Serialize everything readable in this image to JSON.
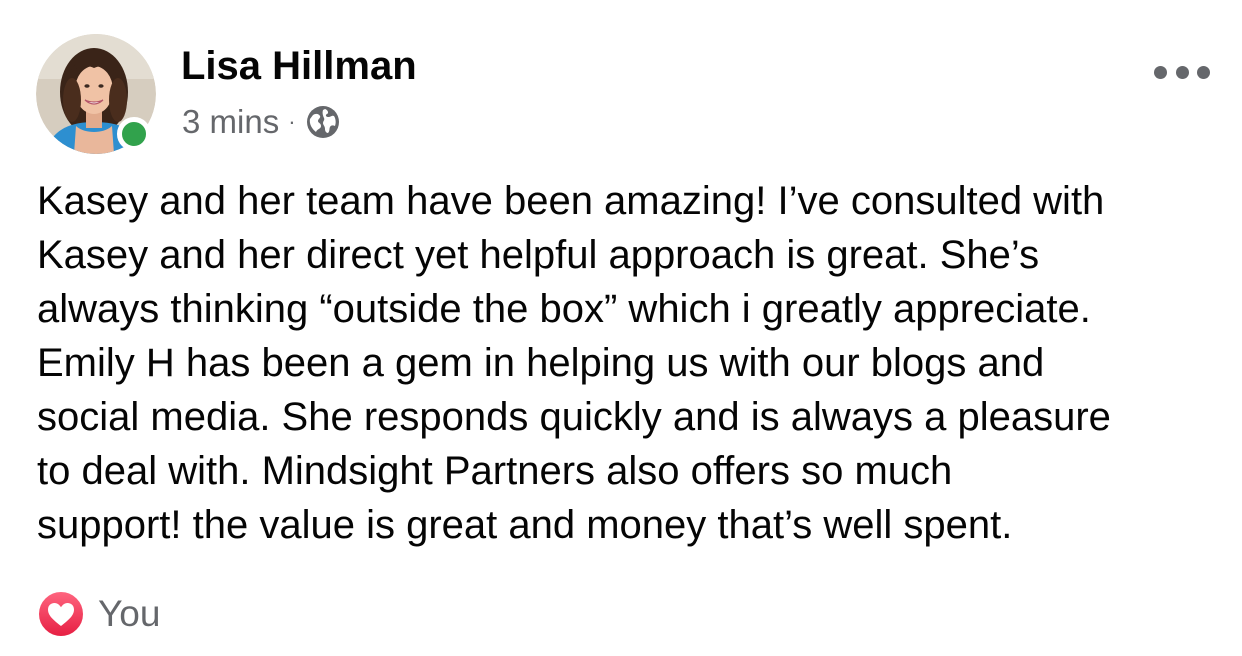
{
  "post": {
    "author": "Lisa Hillman",
    "timestamp": "3 mins",
    "separator": "·",
    "privacy_icon": "globe-icon",
    "online": true,
    "more_icon": "more-horizontal-icon",
    "body_lines": [
      "Kasey and her team have been amazing! I’ve consulted with",
      "Kasey and her direct yet helpful approach is great. She’s",
      "always thinking “outside the box” which i greatly appreciate.",
      "Emily H has been a gem in helping us with our blogs and",
      "social media. She responds quickly and is always a pleasure",
      "to deal with. Mindsight Partners also offers so much",
      "support! the value is great and money that’s well spent."
    ],
    "reactions": {
      "icon": "love-reaction-icon",
      "label": "You"
    }
  },
  "colors": {
    "text_primary": "#050505",
    "text_secondary": "#65676b",
    "online_green": "#31a24c",
    "love_red": "#f33e58"
  }
}
